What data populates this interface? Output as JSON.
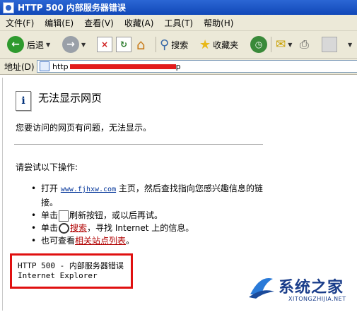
{
  "window": {
    "title": "HTTP 500 内部服务器错误"
  },
  "menu": [
    "文件(F)",
    "编辑(E)",
    "查看(V)",
    "收藏(A)",
    "工具(T)",
    "帮助(H)"
  ],
  "toolbar": {
    "back_label": "后退",
    "search_label": "搜索",
    "favorites_label": "收藏夹"
  },
  "address": {
    "label": "地址(D)",
    "url_prefix": "http",
    "url_suffix": "p"
  },
  "page": {
    "heading": "无法显示网页",
    "intro": "您要访问的网页有问题，无法显示。",
    "try_label": "请尝试以下操作:",
    "items": [
      {
        "pre": "打开 ",
        "link": "www.fjhxw.com",
        "post": " 主页，然后查找指向您感兴趣信息的链接。"
      },
      {
        "pre": "单击",
        "post": "刷新按钮，或以后再试。"
      },
      {
        "pre": "单击",
        "link": "搜索",
        "post": "，寻找 Internet 上的信息。"
      },
      {
        "pre": "也可查看",
        "link": "相关站点列表",
        "post": "。"
      }
    ],
    "error_line1": "HTTP 500 - 内部服务器错误",
    "error_line2": "Internet Explorer"
  },
  "watermark": {
    "name": "系统之家",
    "url": "XITONGZHIJIA.NET"
  }
}
